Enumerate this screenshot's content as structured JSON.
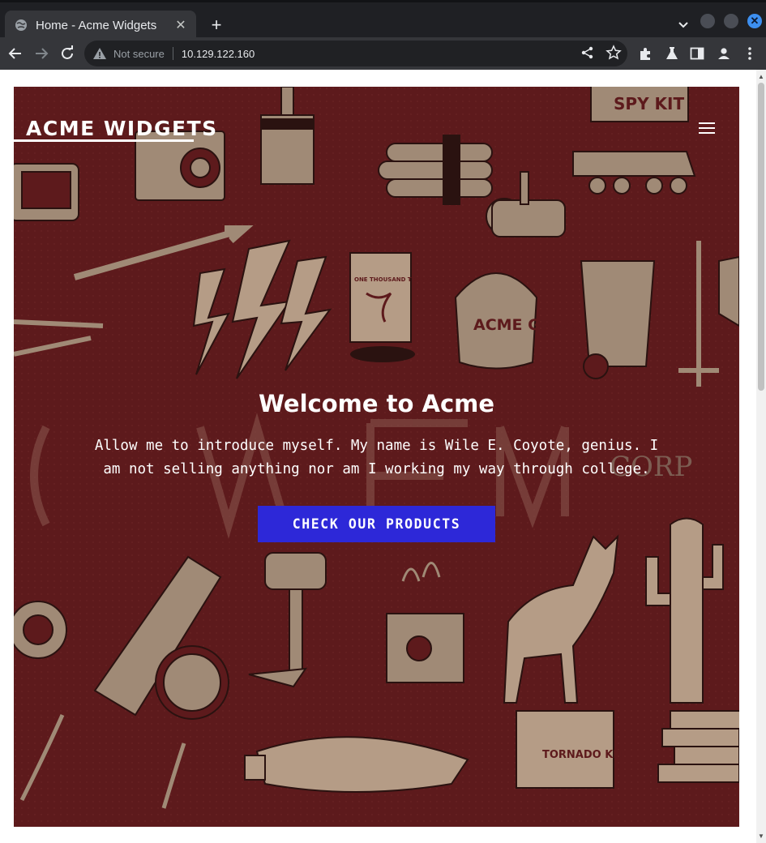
{
  "browser": {
    "tab_title": "Home - Acme Widgets",
    "security_label": "Not secure",
    "url": "10.129.122.160",
    "accent_color": "#3d8ff0"
  },
  "page": {
    "brand": "ACME WIDGETS",
    "heading": "Welcome to Acme",
    "intro": "Allow me to introduce myself. My name is Wile E. Coyote, genius. I am not selling anything nor am I working my way through college.",
    "cta_label": "CHECK OUR PRODUCTS",
    "hero_color": "#5d1a1c",
    "cta_color": "#2d28d8",
    "illustration_texts": {
      "spy_kit": "SPY KIT",
      "tornado_seeds": "ONE THOUSAND TORNADO SEEDS",
      "grease": "ACME GREASE",
      "tornado_kit": "TORNADO KIT",
      "corp": "CORP"
    }
  }
}
